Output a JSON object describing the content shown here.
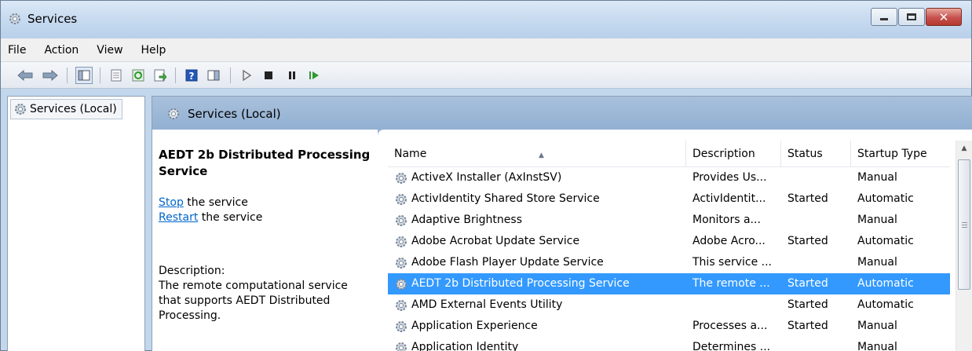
{
  "window": {
    "title": "Services"
  },
  "menu": [
    "File",
    "Action",
    "View",
    "Help"
  ],
  "toolbar": {
    "icons": [
      "back-arrow-icon",
      "forward-arrow-icon",
      "show-hide-console-tree-icon",
      "properties-icon",
      "refresh-icon",
      "export-list-icon",
      "help-icon",
      "show-hide-action-pane-icon",
      "start-service-icon",
      "stop-service-icon",
      "pause-service-icon",
      "resume-service-icon"
    ]
  },
  "tree": {
    "root_label": "Services (Local)"
  },
  "pane": {
    "header_title": "Services (Local)",
    "extended": {
      "title": "AEDT 2b Distributed Processing Service",
      "stop_link": "Stop",
      "stop_text": " the service",
      "restart_link": "Restart",
      "restart_text": " the service",
      "description_label": "Description:",
      "description": "The remote computational service that supports AEDT Distributed Processing."
    }
  },
  "table": {
    "columns": [
      "Name",
      "Description",
      "Status",
      "Startup Type"
    ],
    "rows": [
      {
        "name": "ActiveX Installer (AxInstSV)",
        "description": "Provides Us...",
        "status": "",
        "startup": "Manual",
        "selected": false
      },
      {
        "name": "ActivIdentity Shared Store Service",
        "description": "ActivIdentit...",
        "status": "Started",
        "startup": "Automatic",
        "selected": false
      },
      {
        "name": "Adaptive Brightness",
        "description": "Monitors a...",
        "status": "",
        "startup": "Manual",
        "selected": false
      },
      {
        "name": "Adobe Acrobat Update Service",
        "description": "Adobe Acro...",
        "status": "Started",
        "startup": "Automatic",
        "selected": false
      },
      {
        "name": "Adobe Flash Player Update Service",
        "description": "This service ...",
        "status": "",
        "startup": "Manual",
        "selected": false
      },
      {
        "name": "AEDT 2b Distributed Processing Service",
        "description": "The remote ...",
        "status": "Started",
        "startup": "Automatic",
        "selected": true
      },
      {
        "name": "AMD External Events Utility",
        "description": "",
        "status": "Started",
        "startup": "Automatic",
        "selected": false
      },
      {
        "name": "Application Experience",
        "description": "Processes a...",
        "status": "Started",
        "startup": "Manual",
        "selected": false
      },
      {
        "name": "Application Identity",
        "description": "Determines ...",
        "status": "",
        "startup": "Manual",
        "selected": false
      }
    ]
  },
  "colors": {
    "selection": "#3399ff",
    "link": "#0066cc",
    "header": "#a8c0dc"
  }
}
